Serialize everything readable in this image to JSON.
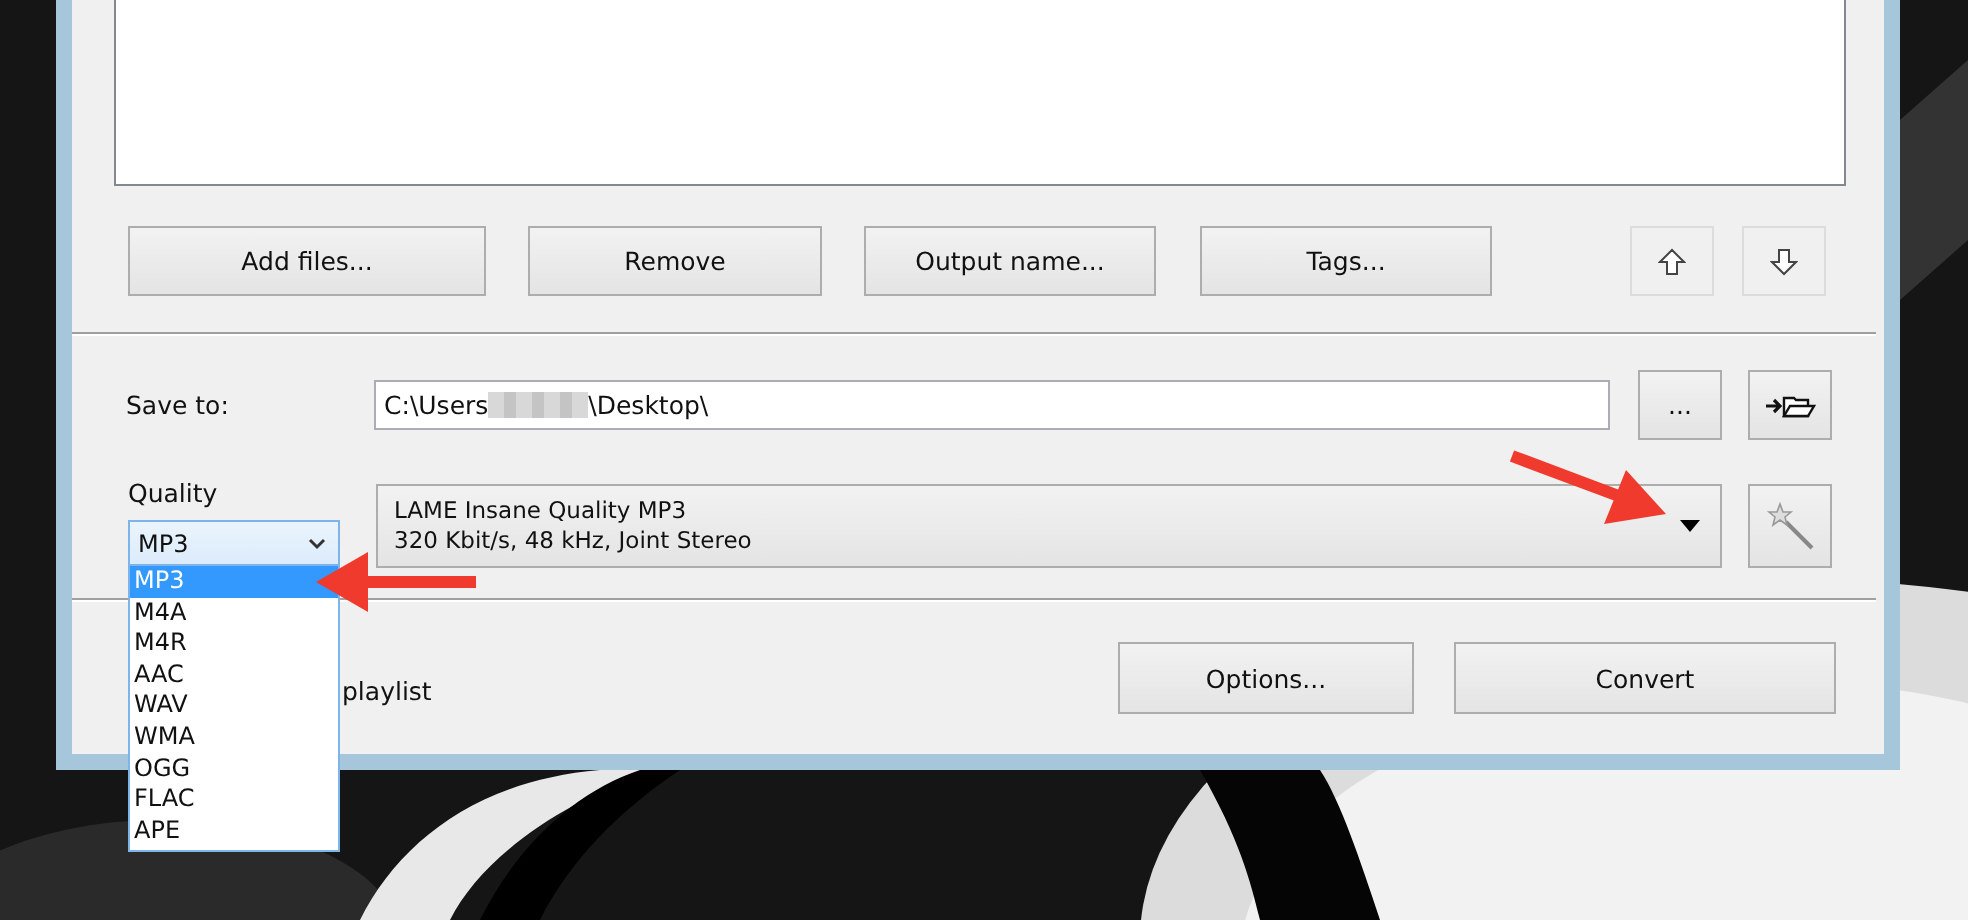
{
  "list_buttons": [
    {
      "label": "Add files..."
    },
    {
      "label": "Remove"
    },
    {
      "label": "Output name..."
    },
    {
      "label": "Tags..."
    }
  ],
  "move_buttons": [
    {
      "kind": "up"
    },
    {
      "kind": "down"
    }
  ],
  "save_to": {
    "label": "Save to:",
    "path_start": "C:\\Users",
    "path_end": "\\Desktop\\",
    "browse_button": "..."
  },
  "quality": {
    "label": "Quality",
    "format": "MP3",
    "preset_lines": [
      "LAME Insane Quality MP3",
      "320 Kbit/s, 48 kHz, Joint Stereo"
    ],
    "format_options": [
      {
        "label": "MP3",
        "selected": true
      },
      {
        "label": "M4A",
        "selected": false
      },
      {
        "label": "M4R",
        "selected": false
      },
      {
        "label": "AAC",
        "selected": false
      },
      {
        "label": "WAV",
        "selected": false
      },
      {
        "label": "WMA",
        "selected": false
      },
      {
        "label": "OGG",
        "selected": false
      },
      {
        "label": "FLAC",
        "selected": false
      },
      {
        "label": "APE",
        "selected": false
      }
    ]
  },
  "playlist_option": {
    "label": "playlist"
  },
  "action_buttons": [
    {
      "label": "Options..."
    },
    {
      "label": "Convert"
    }
  ]
}
